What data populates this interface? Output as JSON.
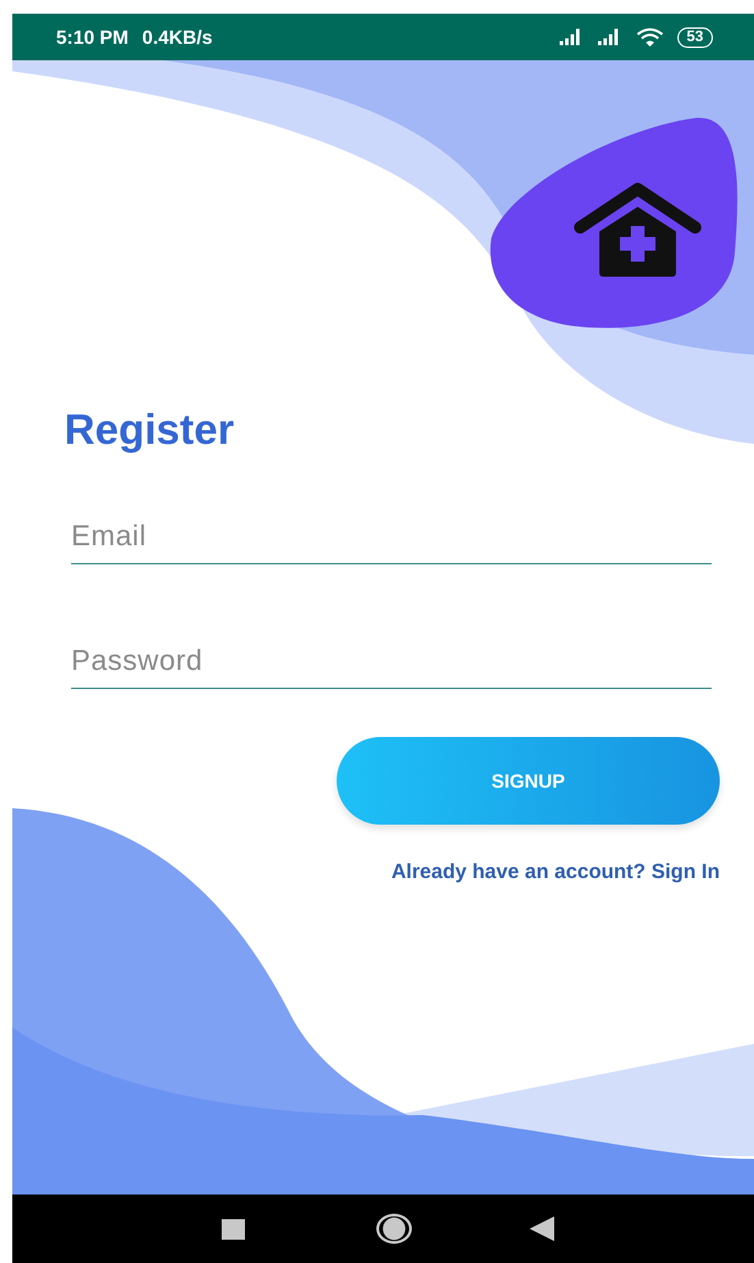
{
  "status_bar": {
    "time": "5:10 PM",
    "speed": "0.4KB/s",
    "battery": "53"
  },
  "title": "Register",
  "fields": [
    {
      "placeholder": "Email"
    },
    {
      "placeholder": "Password"
    }
  ],
  "signup_button": "SIGNUP",
  "signin_link": "Already have an account? Sign In"
}
